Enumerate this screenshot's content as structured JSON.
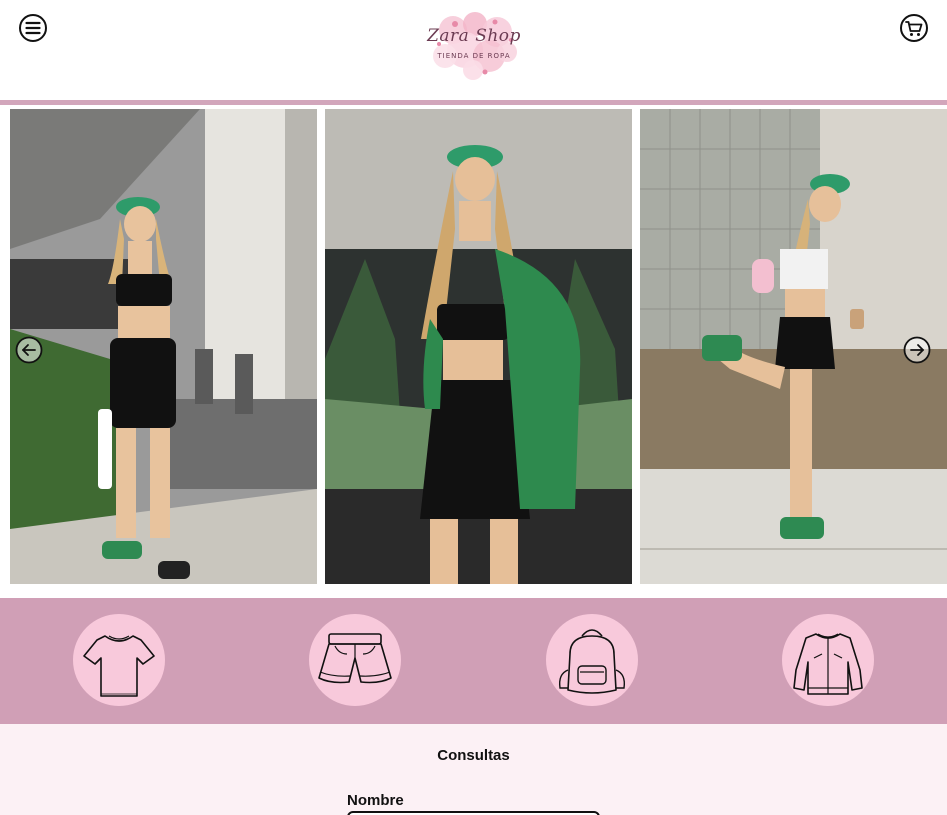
{
  "header": {
    "logo_title": "Zara Shop",
    "logo_subtitle": "TIENDA DE ROPA",
    "menu_icon": "hamburger-menu-icon",
    "cart_icon": "shopping-cart-icon",
    "divider_color": "#d2a6bb"
  },
  "carousel": {
    "slides": [
      {
        "name": "outfit-green-cap-black-set-parking"
      },
      {
        "name": "outfit-green-cap-green-shirt"
      },
      {
        "name": "outfit-green-cap-black-skirt-sneakers"
      }
    ],
    "prev_icon": "arrow-left-icon",
    "next_icon": "arrow-right-icon"
  },
  "categories": {
    "background": "#d09fb6",
    "circle_color": "#f8c9db",
    "items": [
      {
        "icon": "tshirt-icon"
      },
      {
        "icon": "shorts-icon"
      },
      {
        "icon": "backpack-icon"
      },
      {
        "icon": "jacket-icon"
      }
    ]
  },
  "contact": {
    "title": "Consultas",
    "name_label": "Nombre",
    "name_value": ""
  }
}
